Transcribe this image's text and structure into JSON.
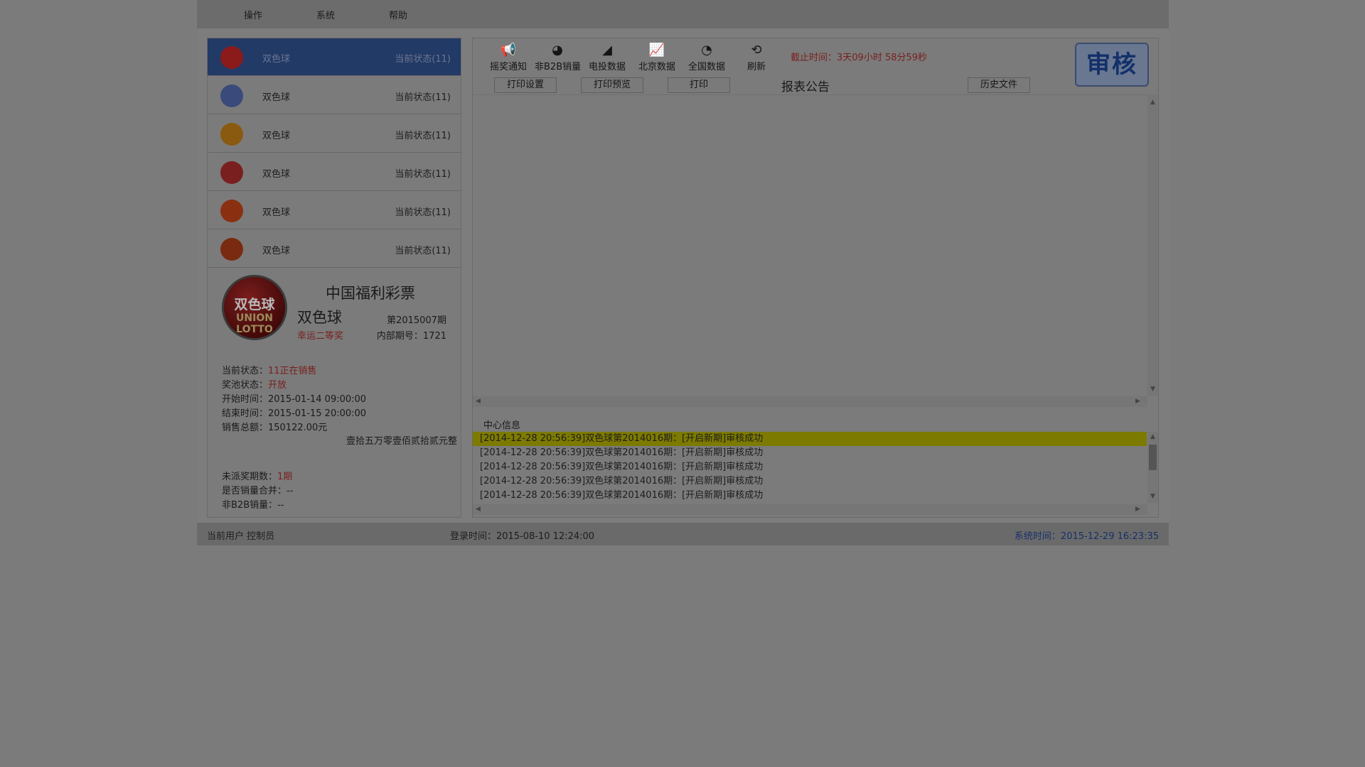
{
  "menu": {
    "items": [
      "操作",
      "系统",
      "帮助"
    ]
  },
  "lotteries": [
    {
      "name": "双色球",
      "status": "当前状态(11)",
      "logo_color": "#8b1a1a"
    },
    {
      "name": "双色球",
      "status": "当前状态(11)",
      "logo_color": "#3a4a7a"
    },
    {
      "name": "双色球",
      "status": "当前状态(11)",
      "logo_color": "#8a5a10"
    },
    {
      "name": "双色球",
      "status": "当前状态(11)",
      "logo_color": "#7a1f1f"
    },
    {
      "name": "双色球",
      "status": "当前状态(11)",
      "logo_color": "#8a3010"
    },
    {
      "name": "双色球",
      "status": "当前状态(11)",
      "logo_color": "#7a2a10"
    }
  ],
  "detail": {
    "logo_text_top": "双色球",
    "logo_text_bottom": "UNION LOTTO",
    "org": "中国福利彩票",
    "name": "双色球",
    "period": "第2015007期",
    "lucky": "幸运二等奖",
    "internal": "内部期号：1721",
    "status_label": "当前状态：",
    "status_value": "11正在销售",
    "pool_label": "奖池状态：",
    "pool_value": "开放",
    "start_time": "开始时间：2015-01-14 09:00:00",
    "end_time": "结束时间：2015-01-15 20:00:00",
    "total_sales": "销售总额：150122.00元",
    "amount_words": "壹拾五万零壹佰贰拾贰元整",
    "unpaid_label": "未派奖期数：",
    "unpaid_value": "1期",
    "merged": "是否销量合并：--",
    "non_b2b": "非B2B销量：--"
  },
  "toolbar": {
    "tools": [
      {
        "label": "摇奖通知",
        "icon": "megaphone-icon",
        "glyph": "📢"
      },
      {
        "label": "非B2B销量",
        "icon": "pie-chart-icon",
        "glyph": "◕"
      },
      {
        "label": "电投数据",
        "icon": "area-chart-icon",
        "glyph": "◢"
      },
      {
        "label": "北京数据",
        "icon": "line-chart-icon",
        "glyph": "📈"
      },
      {
        "label": "全国数据",
        "icon": "pie-icon",
        "glyph": "◔"
      },
      {
        "label": "刷新",
        "icon": "refresh-icon",
        "glyph": "⟲"
      }
    ],
    "deadline": "截止时间：3天09小时 58分59秒",
    "audit_label": "审核"
  },
  "tabs": {
    "print_settings": "打印设置",
    "print_preview": "打印预览",
    "print": "打印",
    "report_title": "报表公告",
    "history": "历史文件"
  },
  "center_info": {
    "label": "中心信息",
    "logs": [
      "[2014-12-28 20:56:39]双色球第2014016期：[开启新期]审核成功",
      "[2014-12-28 20:56:39]双色球第2014016期：[开启新期]审核成功",
      "[2014-12-28 20:56:39]双色球第2014016期：[开启新期]审核成功",
      "[2014-12-28 20:56:39]双色球第2014016期：[开启新期]审核成功",
      "[2014-12-28 20:56:39]双色球第2014016期：[开启新期]审核成功"
    ]
  },
  "statusbar": {
    "user": "当前用户 控制员",
    "login_time": "登录时间：2015-08-10 12:24:00",
    "system_time": "系统时间：2015-12-29 16:23:35"
  }
}
